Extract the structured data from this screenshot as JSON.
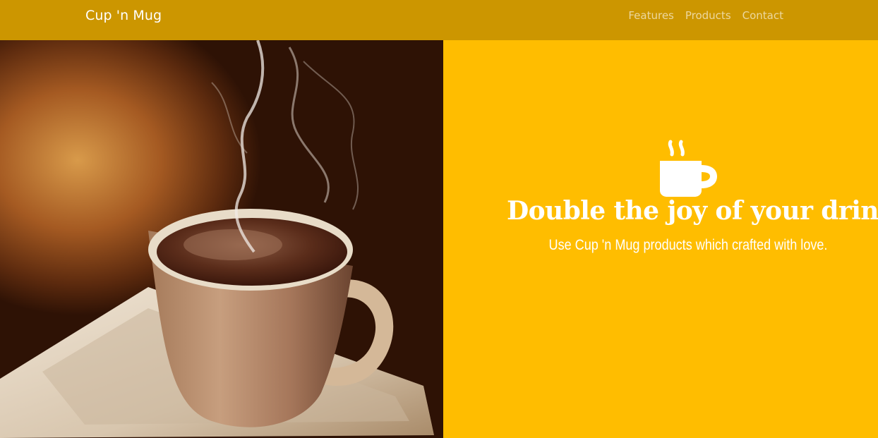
{
  "navbar": {
    "brand": "Cup 'n Mug",
    "links": [
      "Features",
      "Products",
      "Contact"
    ]
  },
  "hero": {
    "image_icon": "coffee-cup-photo",
    "icon": "mug-icon",
    "headline": "Double the joy of your drink.",
    "subline": "Use Cup 'n Mug products which crafted with love."
  },
  "colors": {
    "navbar_bg": "#cc9600",
    "hero_bg": "#ffbd00",
    "text": "#ffffff"
  }
}
